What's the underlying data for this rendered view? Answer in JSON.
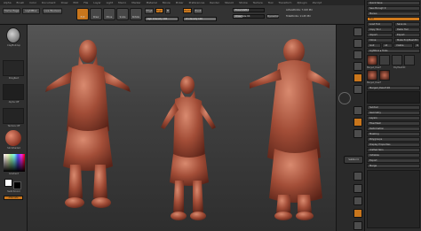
{
  "menu": {
    "items": [
      "Alpha",
      "Brush",
      "Color",
      "Document",
      "Draw",
      "Edit",
      "File",
      "Layer",
      "Light",
      "Macro",
      "Marker",
      "Material",
      "Movie",
      "Picker",
      "Preferences",
      "Render",
      "Stencil",
      "Stroke",
      "Texture",
      "Tool",
      "Transform",
      "Zplugin",
      "Zscript"
    ]
  },
  "toolbar": {
    "home_label": "Home Page",
    "lightbox_label": "LightBox",
    "liveboolean_label": "Live Boolean",
    "edit_label": "Edit",
    "draw_label": "Draw",
    "move_label": "Move",
    "scale_label": "Scale",
    "rotate_label": "Rotate",
    "mrgb_label": "Mrgb",
    "rgb_label": "Rgb",
    "m_label": "M",
    "rgb_intensity_label": "Rgb Intensity 100",
    "zadd_label": "Zadd",
    "zsub_label": "Zsub",
    "z_intensity_label": "Z Intensity 100",
    "focal_shift_label": "Focal Shift 0",
    "draw_size_label": "Draw Size 64",
    "dynamic_label": "Dynamic",
    "active_points_label": "ActivePoints: 7.163 Mil",
    "total_points_label": "TotalPoints: 11.65 Mil"
  },
  "left_shelf": {
    "brush_label": "ClayBuildup",
    "stroke_label": "DragRect",
    "alpha_label": "Alpha Off",
    "texture_label": "Texture Off",
    "material_label": "SkinShade4",
    "gradient_label": "Gradient",
    "switch_label": "SwitchColor",
    "alternate_label": "Alternate"
  },
  "right_nav": {
    "subtool_label": "Subtool 4"
  },
  "tray": {
    "title": "Quick Save",
    "see_through_label": "See-through 0",
    "menus_label": "Menus",
    "tool_label": "Tool",
    "load_tool_label": "Load Tool",
    "save_as_label": "Save As",
    "copy_tool_label": "Copy Tool",
    "paste_tool_label": "Paste Tool",
    "import_label": "Import",
    "export_label": "Export",
    "clone_label": "Clone",
    "make_polymesh_label": "Make PolyMesh3D",
    "goz_label": "GoZ",
    "all_label": "All",
    "visible_label": "Visible",
    "r_label": "R",
    "lightbox_tools_label": "Lightbox ▸ Tools",
    "current_tool_label": "Merged_Dwarf 48",
    "subtool_label": "Subtool",
    "geometry_label": "Geometry",
    "layers_label": "Layers",
    "fibermesh_label": "FiberMesh",
    "deformation_label": "Deformation",
    "masking_label": "Masking",
    "polygroups_label": "Polygroups",
    "display_label": "Display Properties",
    "unified_skin_label": "Unified Skin",
    "initialize_label": "Initialize",
    "export2_label": "Export",
    "merge_label": "Merge",
    "thumbs": [
      "Merged_Dwarf",
      "Cylinder3D",
      "PolyMesh3D",
      "SimpleBrush",
      "Merged_Dwarf",
      "Merged_Dwarf"
    ]
  },
  "colors": {
    "accent": "#e7871f",
    "clay": "#b55a45",
    "background": "#1c1c1c"
  }
}
